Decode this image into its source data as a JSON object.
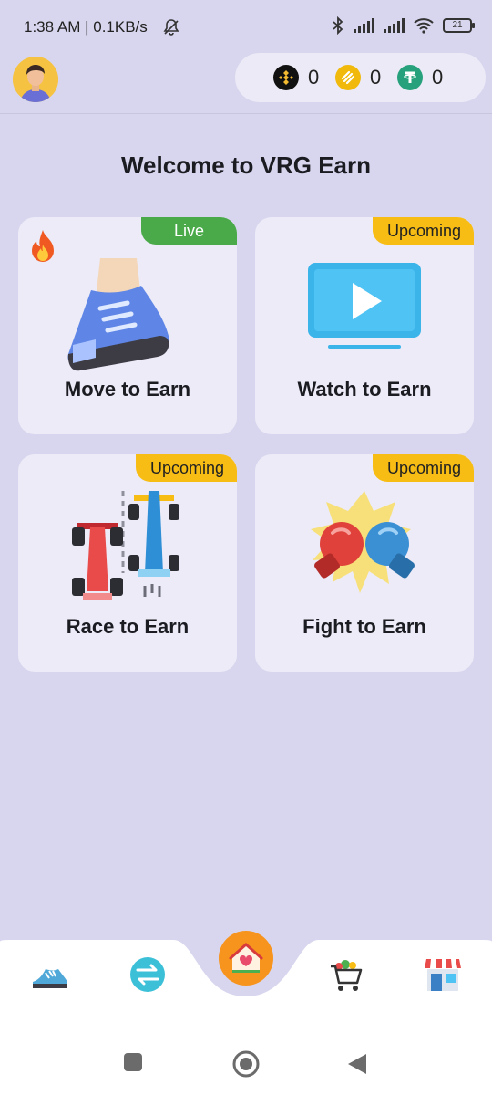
{
  "status": {
    "time": "1:38 AM | 0.1KB/s",
    "battery": "21"
  },
  "balances": [
    {
      "icon": "bnb-coin-icon",
      "value": "0",
      "color": "#f3ba2f"
    },
    {
      "icon": "busd-coin-icon",
      "value": "0",
      "color": "#f0b90b"
    },
    {
      "icon": "usdt-coin-icon",
      "value": "0",
      "color": "#26a17b"
    }
  ],
  "page": {
    "title": "Welcome to VRG Earn"
  },
  "cards": [
    {
      "label": "Move to Earn",
      "badge": "Live"
    },
    {
      "label": "Watch to Earn",
      "badge": "Upcoming"
    },
    {
      "label": "Race to Earn",
      "badge": "Upcoming"
    },
    {
      "label": "Fight to Earn",
      "badge": "Upcoming"
    }
  ],
  "colors": {
    "background": "#d8d6ee",
    "card": "#ecebf7",
    "live": "#4aaa4a",
    "upcoming": "#f7bd14",
    "home": "#f7941d"
  },
  "nav": {
    "items": [
      "sneaker-icon",
      "exchange-icon",
      "home-icon",
      "cart-icon",
      "shop-icon"
    ],
    "active": "home-icon"
  }
}
